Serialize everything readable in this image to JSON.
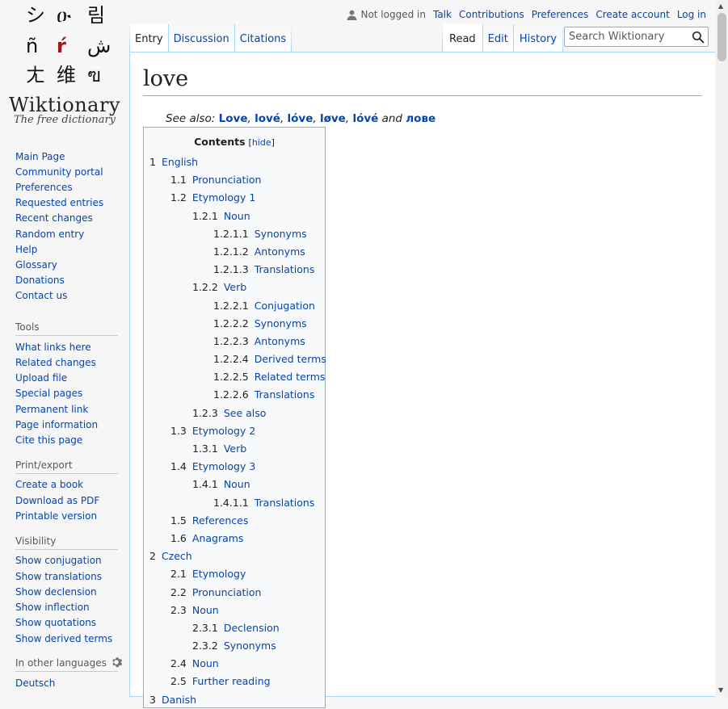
{
  "logo": {
    "glyphs": [
      "シ",
      "ዑ",
      "림",
      "ñ",
      "ŕ",
      "ش",
      "ㄤ",
      "维",
      "ฃ"
    ],
    "wordmark": "Wiktionary",
    "tagline": "The free dictionary"
  },
  "sidebar": {
    "navigation": [
      "Main Page",
      "Community portal",
      "Preferences",
      "Requested entries",
      "Recent changes",
      "Random entry",
      "Help",
      "Glossary",
      "Donations",
      "Contact us"
    ],
    "tools": {
      "heading": "Tools",
      "items": [
        "What links here",
        "Related changes",
        "Upload file",
        "Special pages",
        "Permanent link",
        "Page information",
        "Cite this page"
      ]
    },
    "print": {
      "heading": "Print/export",
      "items": [
        "Create a book",
        "Download as PDF",
        "Printable version"
      ]
    },
    "visibility": {
      "heading": "Visibility",
      "items": [
        "Show conjugation",
        "Show translations",
        "Show declension",
        "Show inflection",
        "Show quotations",
        "Show derived terms"
      ]
    },
    "languages": {
      "heading": "In other languages",
      "items": [
        "Deutsch"
      ]
    }
  },
  "personal": {
    "not_logged_in": "Not logged in",
    "links": [
      "Talk",
      "Contributions",
      "Preferences",
      "Create account",
      "Log in"
    ]
  },
  "tabs": {
    "left": [
      "Entry",
      "Discussion",
      "Citations"
    ],
    "right": [
      "Read",
      "Edit",
      "History"
    ],
    "selected_left": "Entry",
    "selected_right": "Read"
  },
  "search": {
    "placeholder": "Search Wiktionary"
  },
  "page": {
    "title": "love",
    "see_also_label": "See also:",
    "see_also": [
      "Love",
      "lové",
      "lóve",
      "løve",
      "lóvé"
    ],
    "see_also_and": "and",
    "see_also_last": "лове"
  },
  "toc": {
    "title": "Contents",
    "hide": "hide",
    "items": [
      {
        "n": "1",
        "t": "English",
        "lvl": 1
      },
      {
        "n": "1.1",
        "t": "Pronunciation",
        "lvl": 2
      },
      {
        "n": "1.2",
        "t": "Etymology 1",
        "lvl": 2
      },
      {
        "n": "1.2.1",
        "t": "Noun",
        "lvl": 3
      },
      {
        "n": "1.2.1.1",
        "t": "Synonyms",
        "lvl": 4
      },
      {
        "n": "1.2.1.2",
        "t": "Antonyms",
        "lvl": 4
      },
      {
        "n": "1.2.1.3",
        "t": "Translations",
        "lvl": 4
      },
      {
        "n": "1.2.2",
        "t": "Verb",
        "lvl": 3
      },
      {
        "n": "1.2.2.1",
        "t": "Conjugation",
        "lvl": 4
      },
      {
        "n": "1.2.2.2",
        "t": "Synonyms",
        "lvl": 4
      },
      {
        "n": "1.2.2.3",
        "t": "Antonyms",
        "lvl": 4
      },
      {
        "n": "1.2.2.4",
        "t": "Derived terms",
        "lvl": 4
      },
      {
        "n": "1.2.2.5",
        "t": "Related terms",
        "lvl": 4
      },
      {
        "n": "1.2.2.6",
        "t": "Translations",
        "lvl": 4
      },
      {
        "n": "1.2.3",
        "t": "See also",
        "lvl": 3
      },
      {
        "n": "1.3",
        "t": "Etymology 2",
        "lvl": 2
      },
      {
        "n": "1.3.1",
        "t": "Verb",
        "lvl": 3
      },
      {
        "n": "1.4",
        "t": "Etymology 3",
        "lvl": 2
      },
      {
        "n": "1.4.1",
        "t": "Noun",
        "lvl": 3
      },
      {
        "n": "1.4.1.1",
        "t": "Translations",
        "lvl": 4
      },
      {
        "n": "1.5",
        "t": "References",
        "lvl": 2
      },
      {
        "n": "1.6",
        "t": "Anagrams",
        "lvl": 2
      },
      {
        "n": "2",
        "t": "Czech",
        "lvl": 1
      },
      {
        "n": "2.1",
        "t": "Etymology",
        "lvl": 2
      },
      {
        "n": "2.2",
        "t": "Pronunciation",
        "lvl": 2
      },
      {
        "n": "2.3",
        "t": "Noun",
        "lvl": 2
      },
      {
        "n": "2.3.1",
        "t": "Declension",
        "lvl": 3
      },
      {
        "n": "2.3.2",
        "t": "Synonyms",
        "lvl": 3
      },
      {
        "n": "2.4",
        "t": "Noun",
        "lvl": 2
      },
      {
        "n": "2.5",
        "t": "Further reading",
        "lvl": 2
      },
      {
        "n": "3",
        "t": "Danish",
        "lvl": 1
      }
    ]
  }
}
